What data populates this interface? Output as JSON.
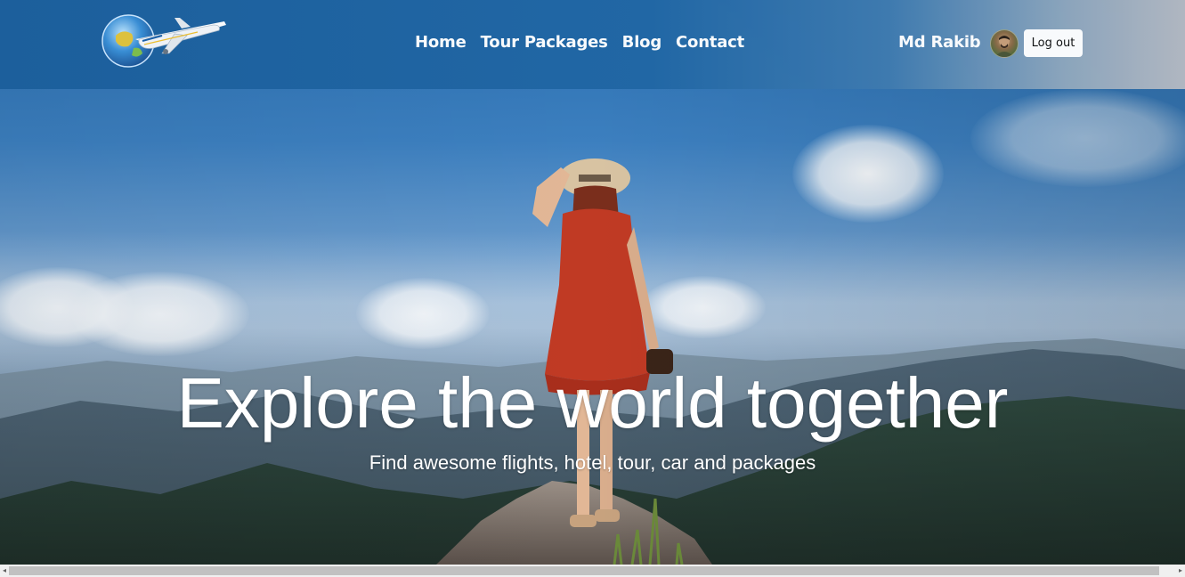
{
  "header": {
    "logo_icon": "globe-airplane-logo",
    "nav": [
      {
        "label": "Home"
      },
      {
        "label": "Tour Packages"
      },
      {
        "label": "Blog"
      },
      {
        "label": "Contact"
      }
    ],
    "user": {
      "name": "Md Rakib",
      "avatar_icon": "user-avatar"
    },
    "logout_label": "Log out"
  },
  "hero": {
    "title": "Explore the world together",
    "subtitle": "Find awesome flights, hotel, tour, car and packages",
    "background_image": "woman-in-red-dress-on-mountain-peak"
  },
  "scrollbar": {
    "left_arrow": "◂",
    "right_arrow": "▸"
  },
  "colors": {
    "header_start": "#1c5f9c",
    "header_end": "#b4b9c2",
    "nav_text": "#ffffff",
    "button_bg": "#ffffff",
    "button_text": "#111111"
  }
}
